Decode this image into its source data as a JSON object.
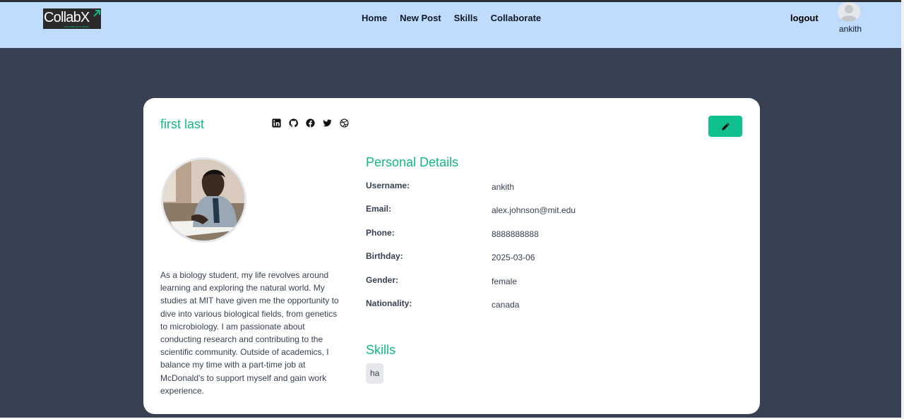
{
  "navbar": {
    "logo_text": "CollabX",
    "logo_tagline": "innovate your ideas",
    "links": [
      {
        "label": "Home"
      },
      {
        "label": "New Post"
      },
      {
        "label": "Skills"
      },
      {
        "label": "Collaborate"
      }
    ],
    "logout_label": "logout",
    "user_name": "ankith"
  },
  "profile": {
    "full_name": "first last",
    "social_icons": [
      "linkedin-icon",
      "github-icon",
      "facebook-icon",
      "twitter-icon",
      "dribbble-icon"
    ],
    "edit_icon": "pencil-icon",
    "bio": "As a biology student, my life revolves around learning and exploring the natural world. My studies at MIT have given me the opportunity to dive into various biological fields, from genetics to microbiology. I am passionate about conducting research and contributing to the scientific community. Outside of academics, I balance my time with a part-time job at McDonald's to support myself and gain work experience."
  },
  "personal_details": {
    "title": "Personal Details",
    "rows": [
      {
        "label": "Username:",
        "value": "ankith"
      },
      {
        "label": "Email:",
        "value": "alex.johnson@mit.edu"
      },
      {
        "label": "Phone:",
        "value": "8888888888"
      },
      {
        "label": "Birthday:",
        "value": "2025-03-06"
      },
      {
        "label": "Gender:",
        "value": "female"
      },
      {
        "label": "Nationality:",
        "value": "canada"
      }
    ]
  },
  "skills": {
    "title": "Skills",
    "items": [
      "ha"
    ]
  },
  "colors": {
    "accent": "#10b981",
    "navbar_bg": "#bfdbfe",
    "page_bg": "#374151",
    "card_bg": "#ffffff"
  }
}
